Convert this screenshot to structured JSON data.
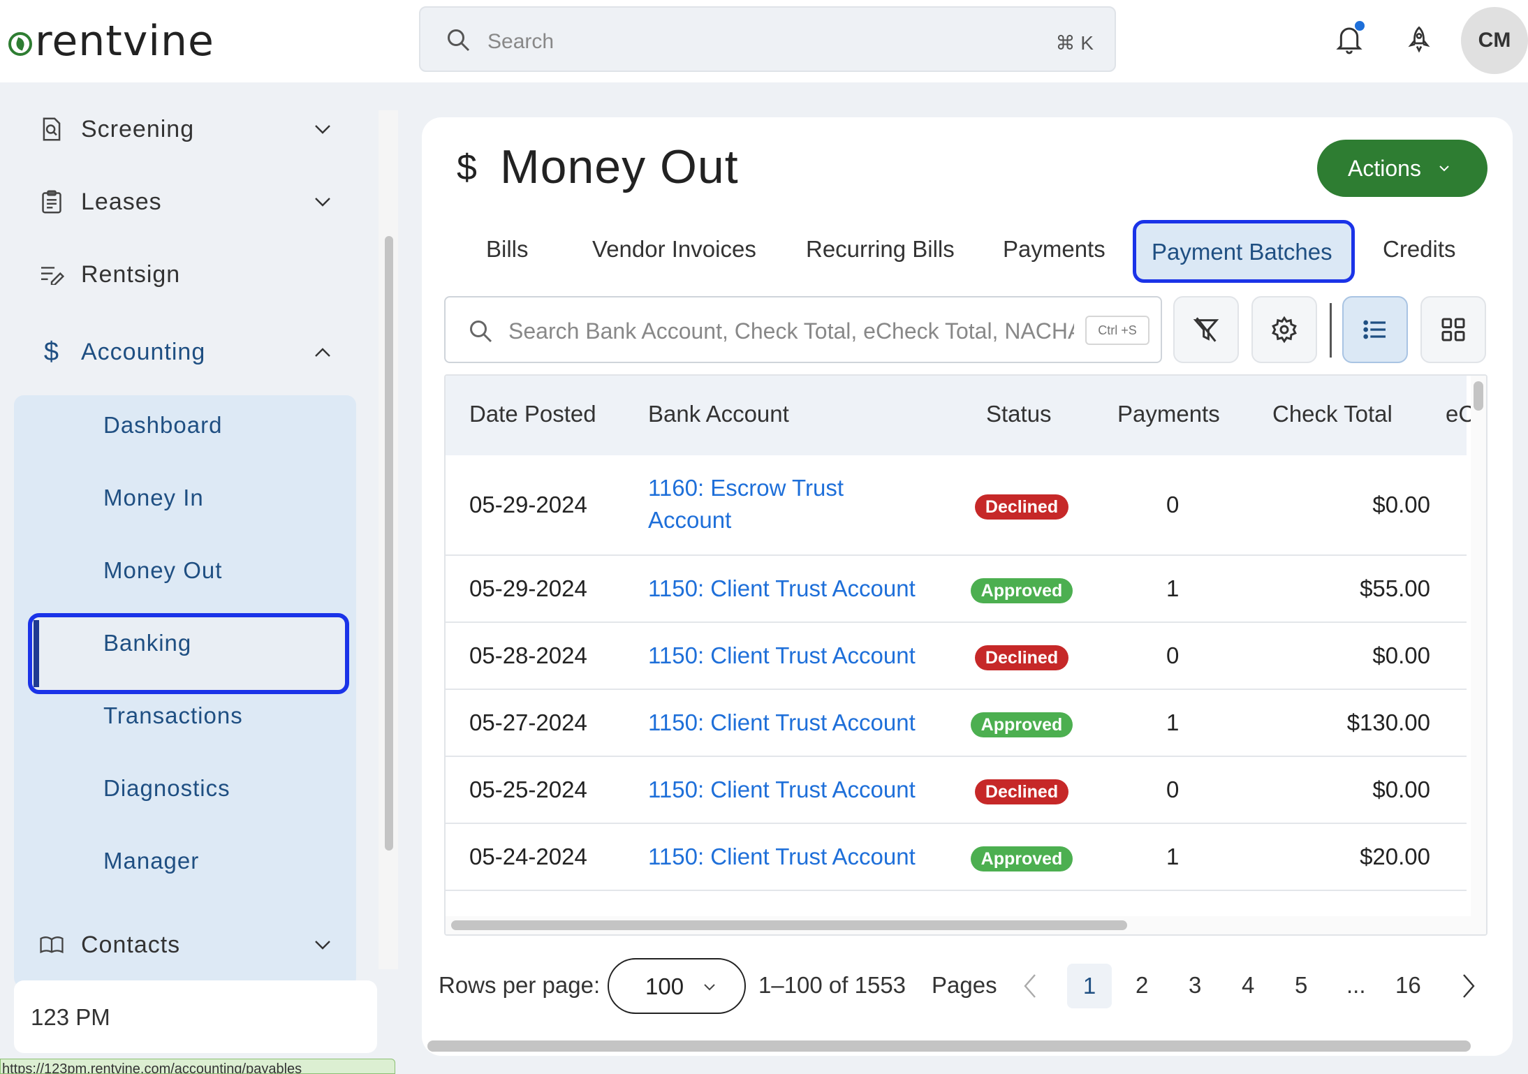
{
  "app": {
    "logo_text": "rentvine",
    "brand_color": "#2e7d32",
    "accent_color": "#1e6fd9"
  },
  "topbar": {
    "search_placeholder": "Search",
    "search_shortcut": "⌘ K",
    "notification_icon": "bell-icon",
    "notification_unread": true,
    "rocket_icon": "rocket-icon",
    "avatar_initials": "CM"
  },
  "sidebar": {
    "items": [
      {
        "label": "Screening",
        "icon": "screening-icon",
        "expandable": true
      },
      {
        "label": "Leases",
        "icon": "clipboard-icon",
        "expandable": true
      },
      {
        "label": "Rentsign",
        "icon": "rentsign-icon",
        "expandable": false
      },
      {
        "label": "Accounting",
        "icon": "dollar-icon",
        "expandable": true,
        "expanded": true
      },
      {
        "label": "Contacts",
        "icon": "book-icon",
        "expandable": true
      }
    ],
    "accounting_sub": [
      "Dashboard",
      "Money In",
      "Money Out",
      "Banking",
      "Transactions",
      "Diagnostics",
      "Manager"
    ],
    "active_sub": "Money Out",
    "footer": "123 PM",
    "status_url": "https://123pm.rentvine.com/accounting/payables"
  },
  "page": {
    "icon": "$",
    "title": "Money Out",
    "actions_label": "Actions",
    "tabs": [
      "Bills",
      "Vendor Invoices",
      "Recurring Bills",
      "Payments",
      "Payment Batches",
      "Credits"
    ],
    "active_tab": "Payment Batches"
  },
  "table_search": {
    "placeholder": "Search Bank Account, Check Total, eCheck Total, NACHA Total",
    "shortcut": "Ctrl +S"
  },
  "table": {
    "columns": [
      "Date Posted",
      "Bank Account",
      "Status",
      "Payments",
      "Check Total",
      "eC"
    ],
    "rows": [
      {
        "date": "05-29-2024",
        "account_line1": "1160: Escrow Trust",
        "account_line2": "Account",
        "status": "Declined",
        "payments": "0",
        "check_total": "$0.00"
      },
      {
        "date": "05-29-2024",
        "account_line1": "1150: Client Trust Account",
        "account_line2": "",
        "status": "Approved",
        "payments": "1",
        "check_total": "$55.00"
      },
      {
        "date": "05-28-2024",
        "account_line1": "1150: Client Trust Account",
        "account_line2": "",
        "status": "Declined",
        "payments": "0",
        "check_total": "$0.00"
      },
      {
        "date": "05-27-2024",
        "account_line1": "1150: Client Trust Account",
        "account_line2": "",
        "status": "Approved",
        "payments": "1",
        "check_total": "$130.00"
      },
      {
        "date": "05-25-2024",
        "account_line1": "1150: Client Trust Account",
        "account_line2": "",
        "status": "Declined",
        "payments": "0",
        "check_total": "$0.00"
      },
      {
        "date": "05-24-2024",
        "account_line1": "1150: Client Trust Account",
        "account_line2": "",
        "status": "Approved",
        "payments": "1",
        "check_total": "$20.00"
      }
    ]
  },
  "pagination": {
    "rows_label": "Rows per page:",
    "rows_value": "100",
    "range": "1–100 of 1553",
    "pages_label": "Pages",
    "pages": [
      "1",
      "2",
      "3",
      "4",
      "5",
      "...",
      "16"
    ],
    "current": "1"
  }
}
